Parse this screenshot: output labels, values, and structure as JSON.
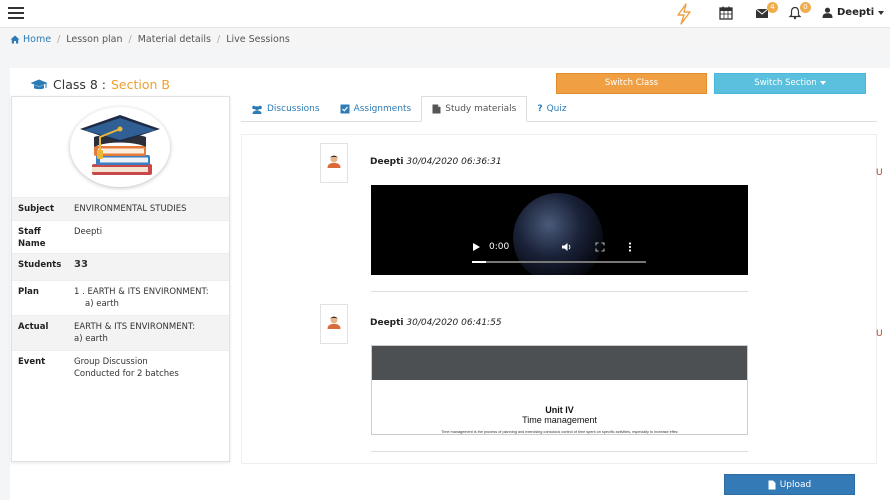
{
  "topbar": {
    "mail_count": "4",
    "notif_count": "0",
    "user_name": "Deepti"
  },
  "breadcrumb": {
    "home": "Home",
    "items": [
      "Lesson plan",
      "Material details",
      "Live Sessions"
    ]
  },
  "header": {
    "class_label": "Class 8 :",
    "section_label": "Section B",
    "switch_class": "Switch Class",
    "switch_section": "Switch Section"
  },
  "info": {
    "subject_key": "Subject",
    "subject_val": "ENVIRONMENTAL STUDIES",
    "staff_key_1": "Staff",
    "staff_key_2": "Name",
    "staff_val": "Deepti",
    "students_key": "Students",
    "students_val": "33",
    "plan_key": "Plan",
    "plan_val_1": "1 . EARTH & ITS ENVIRONMENT:",
    "plan_val_2": "a) earth",
    "actual_key": "Actual",
    "actual_val_1": "EARTH & ITS ENVIRONMENT:",
    "actual_val_2": "a) earth",
    "event_key": "Event",
    "event_val_1": "Group Discussion",
    "event_val_2": "Conducted for 2 batches"
  },
  "tabs": {
    "discussions": "Discussions",
    "assignments": "Assignments",
    "study_materials": "Study materials",
    "quiz": "Quiz"
  },
  "posts": [
    {
      "author": "Deepti",
      "timestamp": "30/04/2020 06:36:31",
      "video_time": "0:00"
    },
    {
      "author": "Deepti",
      "timestamp": "30/04/2020 06:41:55",
      "doc_title": "Unit IV",
      "doc_subtitle": "Time management",
      "doc_text": "Time management is the process of planning and exercising conscious control of time spent on specific activities, especially to increase effec"
    }
  ],
  "edge_marks": [
    "U",
    "U"
  ],
  "upload_label": "Upload",
  "colors": {
    "orange": "#f0a043",
    "info_blue": "#5bc0de",
    "primary": "#337ab7",
    "link": "#2c7bb6"
  }
}
